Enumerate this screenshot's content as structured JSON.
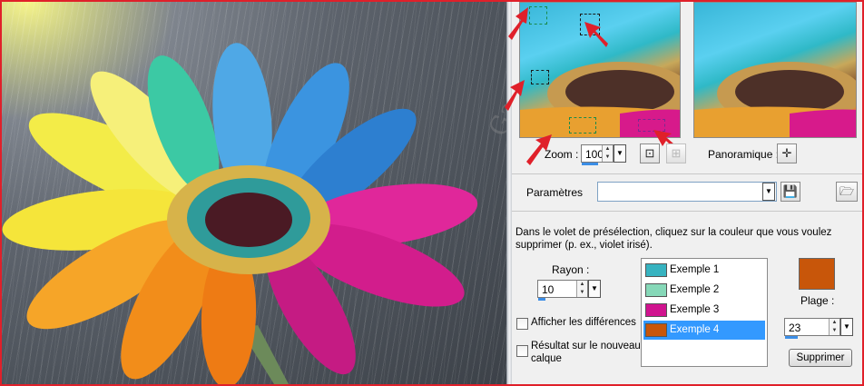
{
  "photo": {
    "icon": "flower-photo"
  },
  "preview": {
    "before_icon": "original-preview",
    "after_icon": "result-preview"
  },
  "zoom": {
    "label": "Zoom :",
    "value": "100",
    "progress": 0.5
  },
  "pan": {
    "label": "Panoramique :"
  },
  "params": {
    "label": "Paramètres",
    "value": ""
  },
  "instructions": "Dans le volet de présélection, cliquez sur la couleur que vous voulez supprimer (p. ex., violet irisé).",
  "radius": {
    "label": "Rayon :",
    "value": "10",
    "progress": 0.15
  },
  "samples": [
    {
      "label": "Exemple 1",
      "color": "#37b3c0",
      "selected": false
    },
    {
      "label": "Exemple 2",
      "color": "#86d8b8",
      "selected": false
    },
    {
      "label": "Exemple 3",
      "color": "#d0148f",
      "selected": false
    },
    {
      "label": "Exemple 4",
      "color": "#c8560a",
      "selected": true
    }
  ],
  "show_diff": {
    "label": "Afficher les différences",
    "checked": false
  },
  "new_layer": {
    "label_line1": "Résultat sur le nouveau",
    "label_line2": "calque",
    "checked": false
  },
  "current_color": "#c8560a",
  "range": {
    "label": "Plage :",
    "value": "23",
    "progress": 0.23
  },
  "delete_button": "Supprimer",
  "accent": "#e0202a"
}
